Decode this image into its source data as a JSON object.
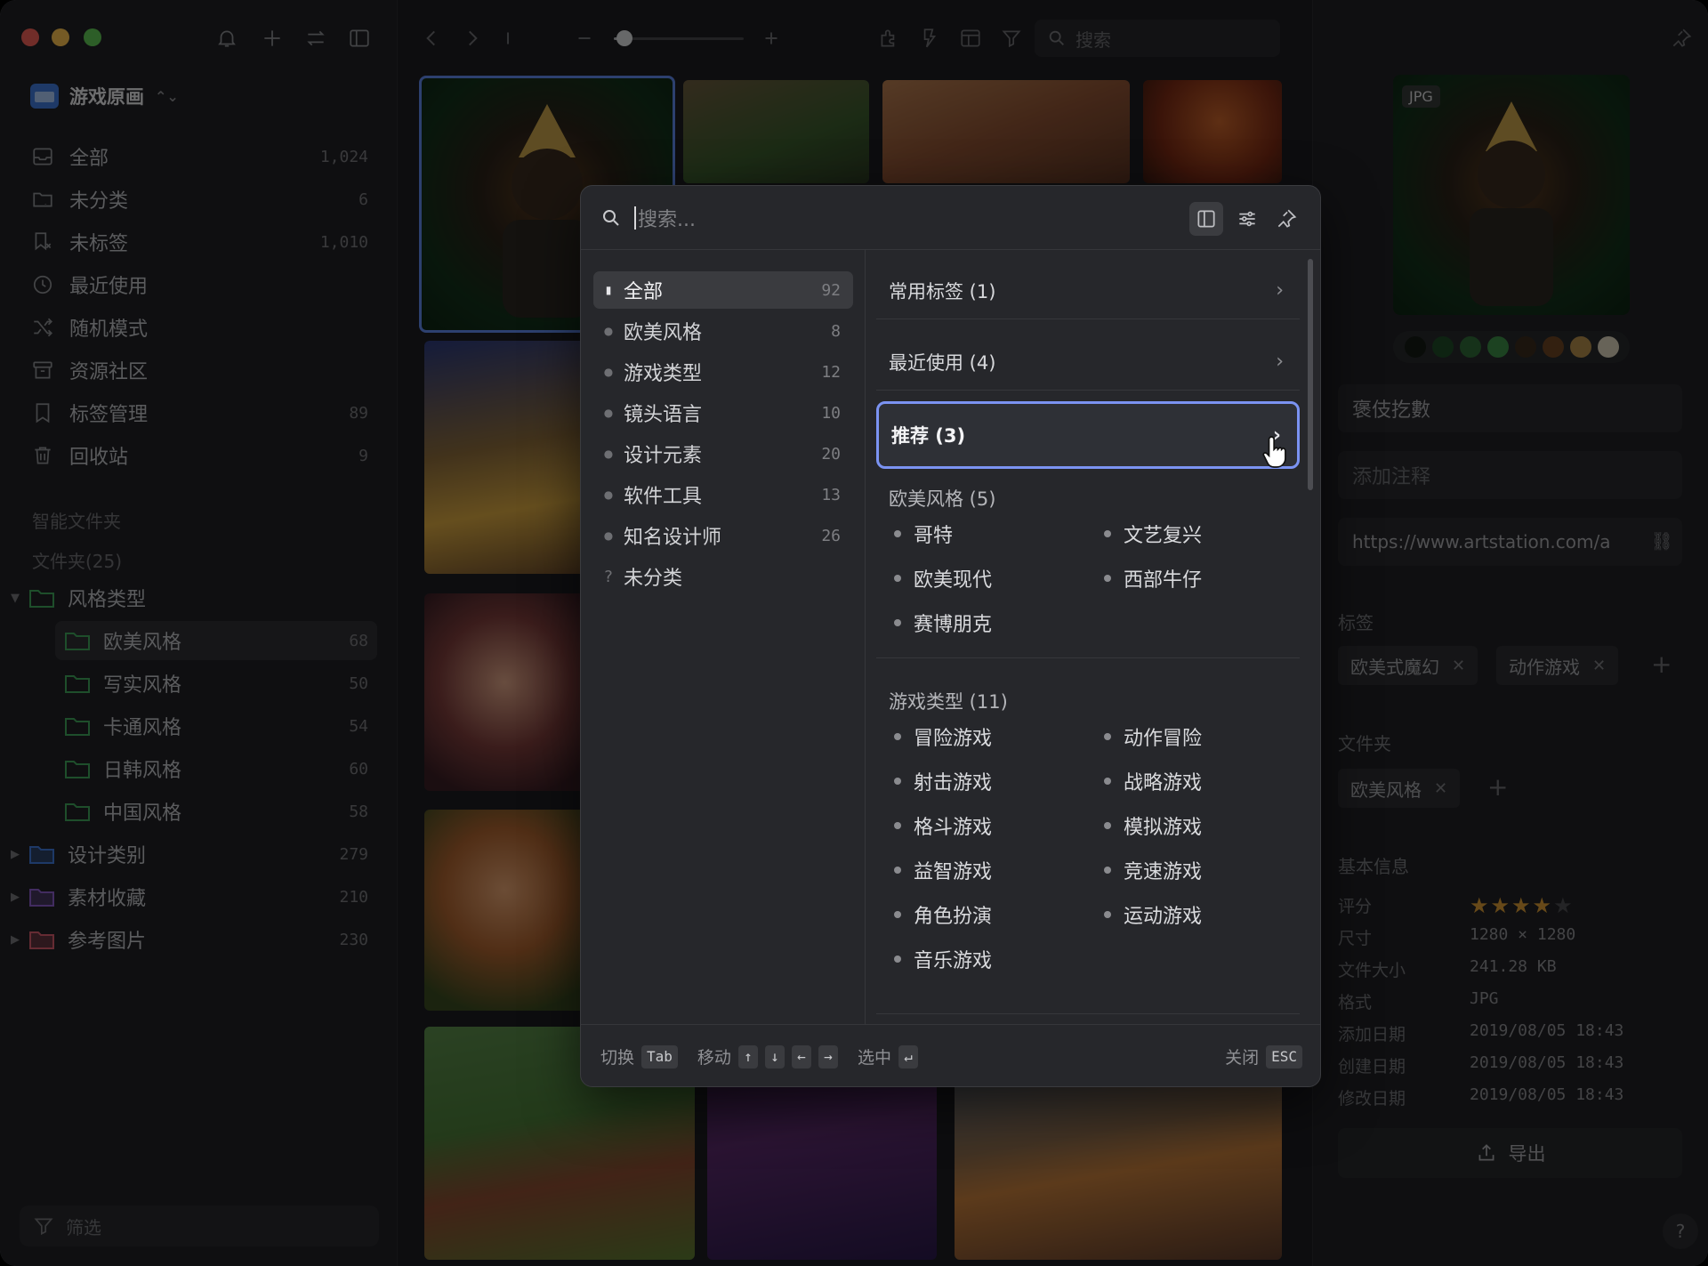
{
  "toolbar": {
    "search_placeholder": "搜索"
  },
  "library": {
    "name": "游戏原画",
    "switch_icon": "chevron-updown-icon"
  },
  "sidebar": {
    "nav": [
      {
        "label": "全部",
        "count": "1,024",
        "icon": "inbox-icon"
      },
      {
        "label": "未分类",
        "count": "6",
        "icon": "folder-question-icon"
      },
      {
        "label": "未标签",
        "count": "1,010",
        "icon": "tag-off-icon"
      },
      {
        "label": "最近使用",
        "count": "",
        "icon": "clock-icon"
      },
      {
        "label": "随机模式",
        "count": "",
        "icon": "shuffle-icon"
      },
      {
        "label": "资源社区",
        "count": "",
        "icon": "archive-icon"
      },
      {
        "label": "标签管理",
        "count": "89",
        "icon": "bookmark-icon"
      },
      {
        "label": "回收站",
        "count": "9",
        "icon": "trash-icon"
      }
    ],
    "smart_folders_title": "智能文件夹",
    "folders_title": "文件夹(25)",
    "folders": [
      {
        "label": "风格类型",
        "count": "",
        "color": "#3fa35a",
        "expanded": true,
        "level": 0
      },
      {
        "label": "欧美风格",
        "count": "68",
        "color": "#3fa35a",
        "level": 1,
        "selected": true
      },
      {
        "label": "写实风格",
        "count": "50",
        "color": "#3fa35a",
        "level": 1
      },
      {
        "label": "卡通风格",
        "count": "54",
        "color": "#3fa35a",
        "level": 1
      },
      {
        "label": "日韩风格",
        "count": "60",
        "color": "#3fa35a",
        "level": 1
      },
      {
        "label": "中国风格",
        "count": "58",
        "color": "#3fa35a",
        "level": 1
      },
      {
        "label": "设计类别",
        "count": "279",
        "color": "#3f78d8",
        "level": 0
      },
      {
        "label": "素材收藏",
        "count": "210",
        "color": "#8a5cc9",
        "level": 0
      },
      {
        "label": "参考图片",
        "count": "230",
        "color": "#d45a6c",
        "level": 0
      }
    ],
    "filter_label": "筛选",
    "zoom_level": 0.05
  },
  "popup": {
    "search_placeholder": "搜索...",
    "categories": [
      {
        "label": "全部",
        "count": "92",
        "bullet": "bookmark",
        "active": true
      },
      {
        "label": "欧美风格",
        "count": "8"
      },
      {
        "label": "游戏类型",
        "count": "12"
      },
      {
        "label": "镜头语言",
        "count": "10"
      },
      {
        "label": "设计元素",
        "count": "20"
      },
      {
        "label": "软件工具",
        "count": "13"
      },
      {
        "label": "知名设计师",
        "count": "26"
      },
      {
        "label": "未分类",
        "count": "",
        "bullet": "?"
      }
    ],
    "groups": [
      {
        "label": "常用标签 (1)"
      },
      {
        "label": "最近使用 (4)"
      },
      {
        "label": "推荐 (3)",
        "highlight": true
      }
    ],
    "sections": [
      {
        "title": "欧美风格 (5)",
        "tags": [
          "哥特",
          "文艺复兴",
          "欧美现代",
          "西部牛仔",
          "赛博朋克"
        ]
      },
      {
        "title": "游戏类型 (11)",
        "tags": [
          "冒险游戏",
          "动作冒险",
          "射击游戏",
          "战略游戏",
          "格斗游戏",
          "模拟游戏",
          "益智游戏",
          "竞速游戏",
          "角色扮演",
          "运动游戏",
          "音乐游戏"
        ]
      }
    ],
    "footer": {
      "switch_label": "切换",
      "switch_key": "Tab",
      "move_label": "移动",
      "move_keys": [
        "↑",
        "↓",
        "←",
        "→"
      ],
      "select_label": "选中",
      "select_key": "↵",
      "close_label": "关闭",
      "close_key": "ESC"
    }
  },
  "inspector": {
    "format_badge": "JPG",
    "palette": [
      "#141a14",
      "#1f4a26",
      "#2f6a37",
      "#3c8a45",
      "#3a2a1c",
      "#6b4422",
      "#b08a4a",
      "#d8cfb8"
    ],
    "title": "褒伎扢數",
    "note_placeholder": "添加注释",
    "url": "https://www.artstation.com/a",
    "tags_title": "标签",
    "tags": [
      "欧美式魔幻",
      "动作游戏"
    ],
    "folders_title": "文件夹",
    "folders": [
      "欧美风格"
    ],
    "info_title": "基本信息",
    "rating_label": "评分",
    "rating": 4,
    "rating_max": 5,
    "info": [
      {
        "k": "尺寸",
        "v": "1280 × 1280"
      },
      {
        "k": "文件大小",
        "v": "241.28 KB"
      },
      {
        "k": "格式",
        "v": "JPG"
      },
      {
        "k": "添加日期",
        "v": "2019/08/05 18:43"
      },
      {
        "k": "创建日期",
        "v": "2019/08/05 18:43"
      },
      {
        "k": "修改日期",
        "v": "2019/08/05 18:43"
      }
    ],
    "export_label": "导出",
    "help_label": "?"
  }
}
